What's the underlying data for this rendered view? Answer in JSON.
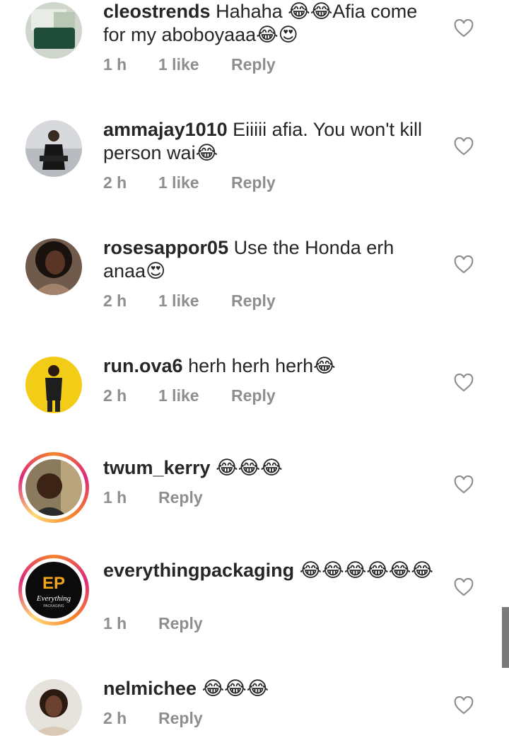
{
  "comments": [
    {
      "username": "cleostrends",
      "text": "Hahaha 😂😂Afia come for my aboboyaaa😂😍",
      "time": "1 h",
      "likes": "1 like",
      "reply": "Reply",
      "has_story": false
    },
    {
      "username": "ammajay1010",
      "text": "Eiiiii afia. You won't kill person wai😂",
      "time": "2 h",
      "likes": "1 like",
      "reply": "Reply",
      "has_story": false
    },
    {
      "username": "rosesappor05",
      "text": "Use the Honda erh anaa😍",
      "time": "2 h",
      "likes": "1 like",
      "reply": "Reply",
      "has_story": false
    },
    {
      "username": "run.ova6",
      "text": "herh herh herh😂",
      "time": "2 h",
      "likes": "1 like",
      "reply": "Reply",
      "has_story": false
    },
    {
      "username": "twum_kerry",
      "text": "😂😂😂",
      "time": "1 h",
      "likes": "",
      "reply": "Reply",
      "has_story": true
    },
    {
      "username": "everythingpackaging",
      "text": "😂😂😂😂😂😂",
      "time": "1 h",
      "likes": "",
      "reply": "Reply",
      "has_story": true,
      "avatar_logo": {
        "mark": "EP",
        "script": "Everything",
        "sub": "PACKAGING"
      }
    },
    {
      "username": "nelmichee",
      "text": "😂😂😂",
      "time": "2 h",
      "likes": "",
      "reply": "Reply",
      "has_story": false
    }
  ]
}
